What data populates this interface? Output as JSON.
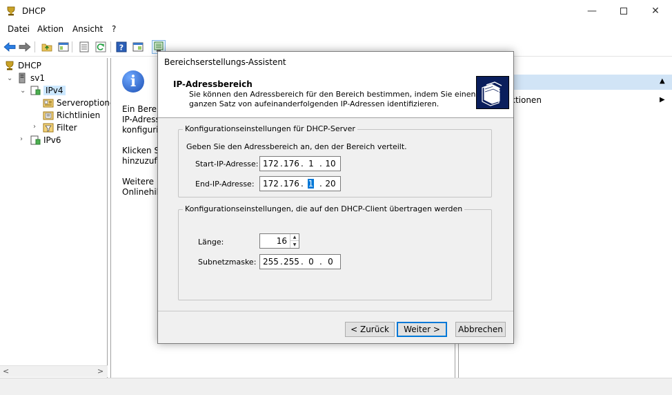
{
  "window": {
    "title": "DHCP"
  },
  "menu": {
    "items": [
      "Datei",
      "Aktion",
      "Ansicht",
      "?"
    ]
  },
  "tree": {
    "root": "DHCP",
    "server": "sv1",
    "ipv4": "IPv4",
    "server_options": "Serveroptionen",
    "policies": "Richtlinien",
    "filter": "Filter",
    "ipv6": "IPv6"
  },
  "center": {
    "line1": "Ein Bereic",
    "line2": "IP-Adresse",
    "line3": "konfigurie",
    "line4": "Klicken Si",
    "line5": "hinzuzufü",
    "line6": "Weitere In",
    "line7": "Onlinehilf"
  },
  "actions": {
    "link": "ktionen"
  },
  "dialog": {
    "title": "Bereichserstellungs-Assistent",
    "heading": "IP-Adressbereich",
    "subtitle": "Sie können den Adressbereich für den Bereich bestimmen, indem Sie einen ganzen Satz von aufeinanderfolgenden IP-Adressen identifizieren.",
    "server_group": {
      "legend": "Konfigurationseinstellungen für DHCP-Server",
      "intro": "Geben Sie den Adressbereich an, den der Bereich verteilt.",
      "start_label": "Start-IP-Adresse:",
      "start_ip": [
        "172",
        "176",
        "1",
        "10"
      ],
      "end_label": "End-IP-Adresse:",
      "end_ip": [
        "172",
        "176",
        "1",
        "20"
      ]
    },
    "client_group": {
      "legend": "Konfigurationseinstellungen, die auf den DHCP-Client übertragen werden",
      "length_label": "Länge:",
      "length_value": "16",
      "mask_label": "Subnetzmaske:",
      "mask": [
        "255",
        "255",
        "0",
        "0"
      ]
    },
    "buttons": {
      "back": "< Zurück",
      "next": "Weiter >",
      "cancel": "Abbrechen"
    }
  },
  "colors": {
    "selection": "#cce8ff",
    "accent": "#0078d7",
    "actions_header": "#d1e4f6",
    "dialog_bg": "#f0f0f0"
  },
  "icons": [
    "dhcp-icon",
    "minimize-icon",
    "maximize-icon",
    "close-icon",
    "back-arrow-icon",
    "forward-arrow-icon",
    "folder-up-icon",
    "show-tree-icon",
    "export-list-icon",
    "refresh-icon",
    "help-icon",
    "properties-icon",
    "new-scope-icon",
    "info-icon",
    "wizard-logo-icon"
  ]
}
